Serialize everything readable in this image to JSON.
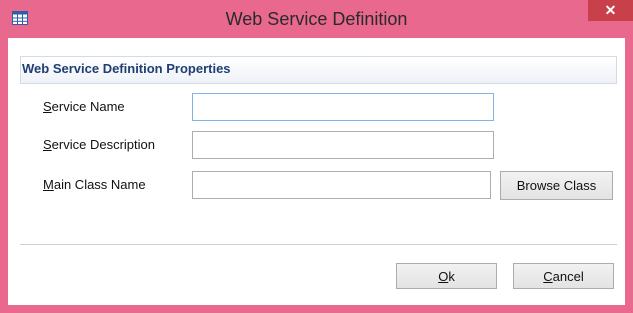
{
  "window": {
    "title": "Web Service Definition",
    "icon": "table-icon",
    "close_glyph": "✕"
  },
  "group": {
    "title": "Web Service Definition Properties"
  },
  "form": {
    "service_name": {
      "label_mnemonic": "S",
      "label_rest": "ervice Name",
      "value": ""
    },
    "service_description": {
      "label_mnemonic": "S",
      "label_rest": "ervice Description",
      "value": ""
    },
    "main_class_name": {
      "label_mnemonic": "M",
      "label_rest": "ain Class Name",
      "value": ""
    }
  },
  "buttons": {
    "browse_class": "Browse Class",
    "ok_mnemonic": "O",
    "ok_rest": "k",
    "cancel_mnemonic": "C",
    "cancel_rest": "ancel"
  },
  "colors": {
    "titlebar": "#e8688e",
    "close_button": "#c7404a",
    "group_title": "#1f3e73",
    "focused_border": "#7eb4ea"
  }
}
